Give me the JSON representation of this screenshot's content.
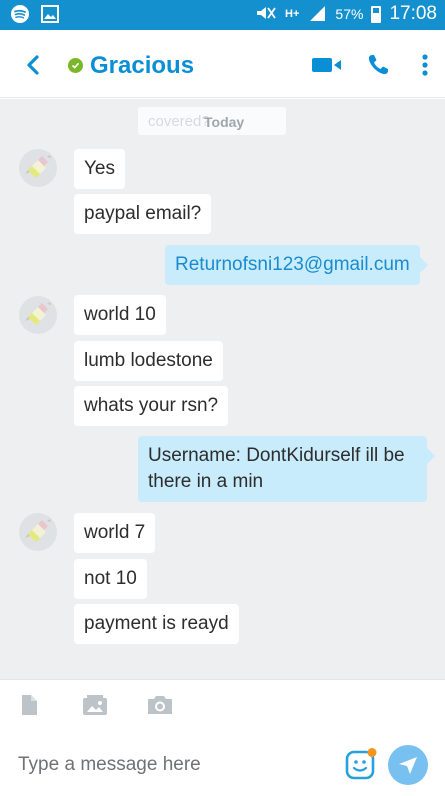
{
  "status_bar": {
    "network": "H+",
    "battery": "57%",
    "time": "17:08",
    "icons": [
      "spotify-icon",
      "image-icon",
      "mute-icon",
      "signal-icon",
      "battery-icon"
    ]
  },
  "header": {
    "contact_name": "Gracious",
    "presence": "online",
    "icons": [
      "back-icon",
      "video-call-icon",
      "call-icon",
      "more-icon"
    ]
  },
  "chat": {
    "date_ghost": "covered?",
    "date_label": "Today",
    "messages": [
      {
        "dir": "in",
        "text": "Yes"
      },
      {
        "dir": "in",
        "text": "paypal email?"
      },
      {
        "dir": "out",
        "text": "Returnofsni123@gmail.cum"
      },
      {
        "dir": "in",
        "text": "world 10"
      },
      {
        "dir": "in",
        "text": "lumb lodestone"
      },
      {
        "dir": "in",
        "text": "whats your rsn?"
      },
      {
        "dir": "out",
        "text": "Username: DontKidurself ill be there in a min"
      },
      {
        "dir": "in",
        "text": "world 7"
      },
      {
        "dir": "in",
        "text": "not 10"
      },
      {
        "dir": "in",
        "text": "payment is reayd"
      }
    ]
  },
  "composer": {
    "placeholder": "Type a message here",
    "tools": [
      "file-icon",
      "media-icon",
      "camera-icon"
    ]
  },
  "colors": {
    "status_bar": "#1590ce",
    "accent": "#0a8fd6",
    "presence": "#7ab72a",
    "chat_bg": "#edeff1",
    "outgoing_bubble": "#c8ecfb",
    "send_button": "#77c0ef"
  }
}
